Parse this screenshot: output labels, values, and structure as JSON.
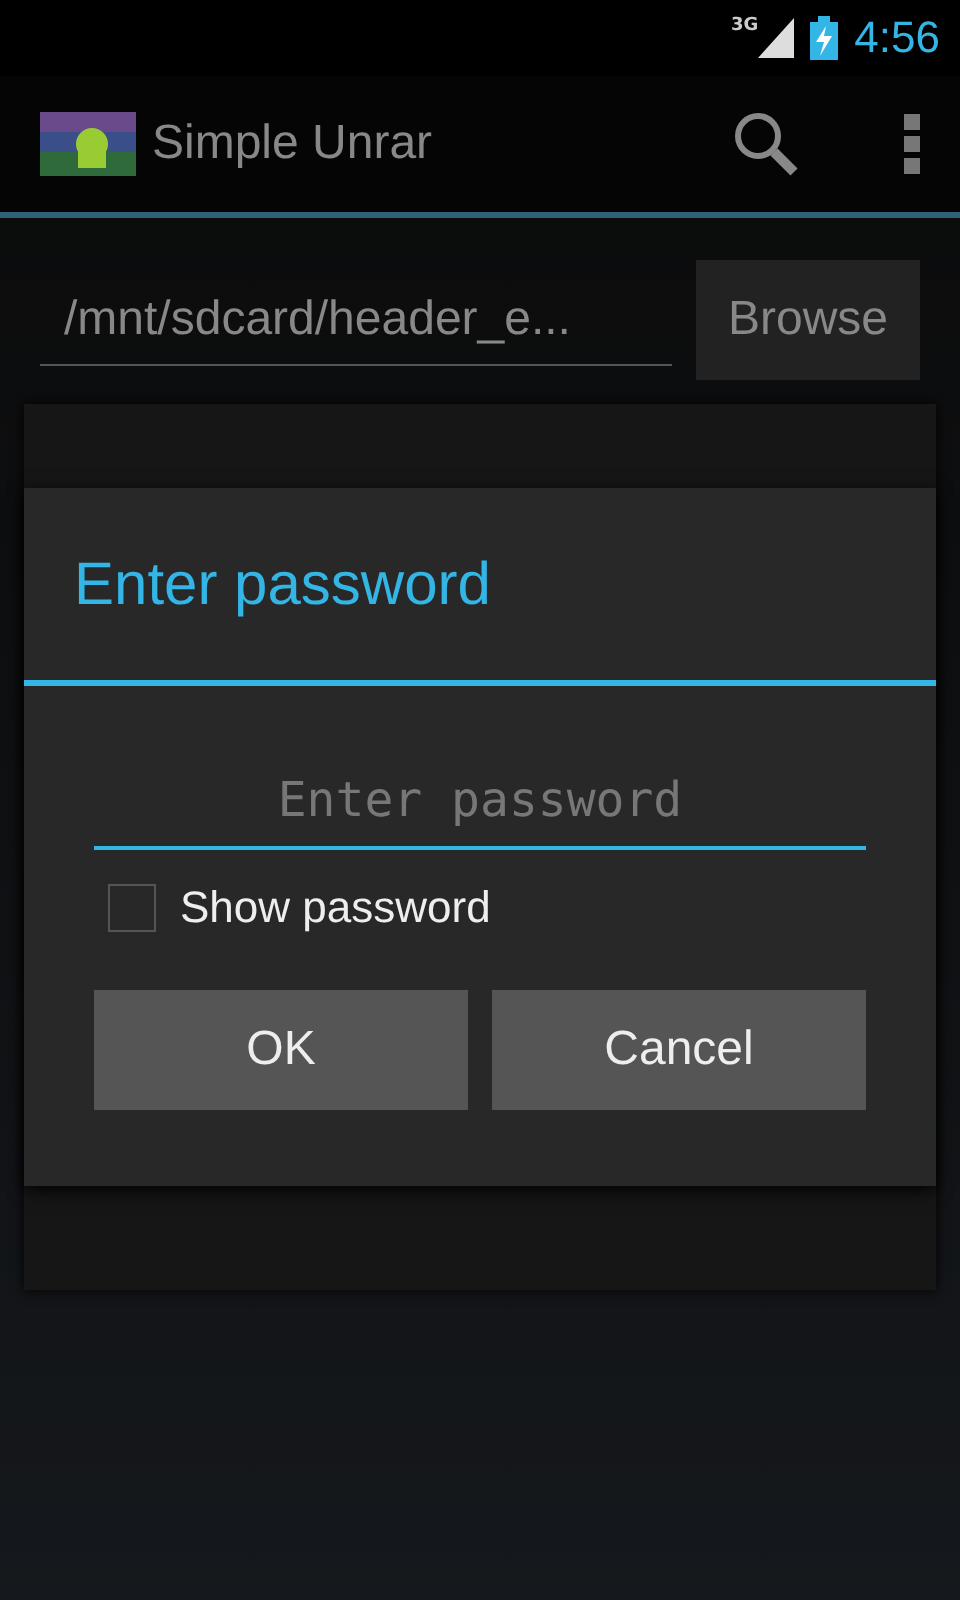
{
  "status_bar": {
    "network": "3G",
    "time": "4:56"
  },
  "action_bar": {
    "title": "Simple Unrar"
  },
  "file_path": {
    "value": "/mnt/sdcard/header_e...",
    "button": "Browse"
  },
  "dialog": {
    "title": "Enter password",
    "field": {
      "placeholder": "Enter password"
    },
    "show_password": {
      "label": "Show password",
      "checked": false
    },
    "buttons": [
      {
        "label": "OK"
      },
      {
        "label": "Cancel"
      }
    ]
  }
}
